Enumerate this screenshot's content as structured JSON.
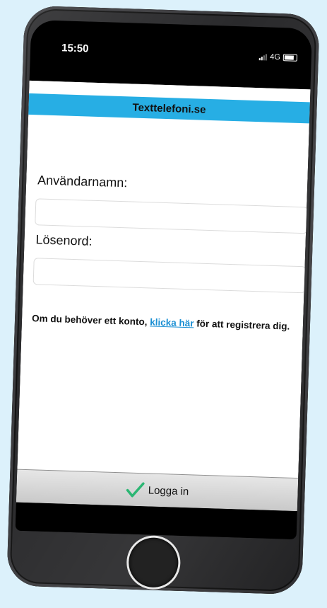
{
  "status_bar": {
    "time": "15:50",
    "network": "4G"
  },
  "app": {
    "title": "Texttelefoni.se",
    "username_label": "Användarnamn:",
    "username_value": "",
    "password_label": "Lösenord:",
    "password_value": "",
    "register_text_before": "Om du behöver ett konto, ",
    "register_link": "klicka här",
    "register_text_after": " för att registrera dig.",
    "login_button": "Logga in"
  },
  "colors": {
    "header_bg": "#27aee4",
    "link": "#1a8fd3",
    "checkmark": "#2bb673",
    "background": "#dcf1fb"
  },
  "icons": [
    "signal-icon",
    "battery-icon",
    "checkmark-icon",
    "home-button"
  ]
}
